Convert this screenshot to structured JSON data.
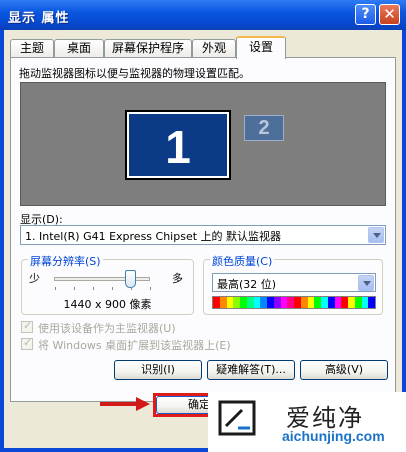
{
  "window": {
    "title": "显示 属性",
    "help_label": "?",
    "close_label": "✕"
  },
  "tabs": [
    {
      "label": "主题"
    },
    {
      "label": "桌面"
    },
    {
      "label": "屏幕保护程序"
    },
    {
      "label": "外观"
    },
    {
      "label": "设置",
      "active": true
    }
  ],
  "settings": {
    "instruction": "拖动监视器图标以便与监视器的物理设置匹配。",
    "monitor1_label": "1",
    "monitor2_label": "2",
    "display_label": "显示(D):",
    "display_value": "1. Intel(R) G41 Express Chipset 上的 默认监视器",
    "resolution": {
      "title": "屏幕分辨率(S)",
      "less_label": "少",
      "more_label": "多",
      "value_text": "1440 x 900 像素",
      "slider_position": 0.8
    },
    "color": {
      "title": "颜色质量(C)",
      "value": "最高(32 位)"
    },
    "checkbox_primary": "使用该设备作为主监视器(U)",
    "checkbox_extend": "将 Windows 桌面扩展到该监视器上(E)",
    "buttons": {
      "identify": "识别(I)",
      "troubleshoot": "疑难解答(T)...",
      "advanced": "高级(V)"
    }
  },
  "dialog_buttons": {
    "ok": "确定"
  },
  "watermark": {
    "title": "爱纯净",
    "url": "aichunjing.com"
  },
  "colors": {
    "title_bar": "#0a57e1",
    "monitor_primary": "#0b3b87",
    "highlight_red": "#e01b1b"
  }
}
